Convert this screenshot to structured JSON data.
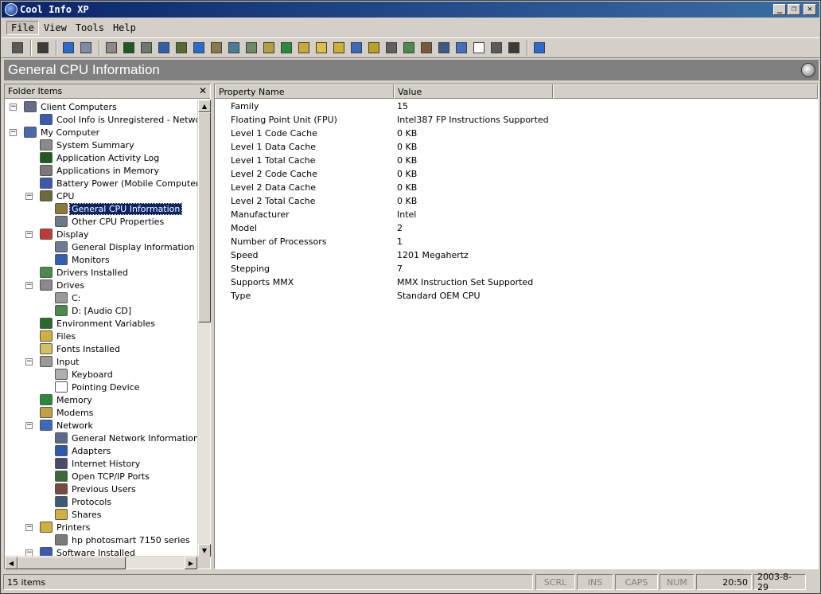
{
  "window": {
    "title": "Cool Info XP"
  },
  "menu": [
    {
      "label": "File",
      "active": true
    },
    {
      "label": "View"
    },
    {
      "label": "Tools"
    },
    {
      "label": "Help"
    }
  ],
  "toolbar": {
    "groups": [
      [
        "print-icon"
      ],
      [
        "connect-icon"
      ],
      [
        "cpu-info-icon",
        "cpu-props-icon"
      ],
      [
        "summary-icon",
        "activity-log-icon",
        "apps-memory-icon",
        "battery-icon",
        "cpu-icon",
        "display-icon",
        "display-info-icon",
        "monitor-icon",
        "drivers-icon",
        "drive-icon",
        "cdrom-icon",
        "env-icon",
        "files-icon",
        "fonts-icon",
        "keyboard-icon",
        "memory-icon",
        "modem-icon",
        "network-icon",
        "adapters-icon",
        "history-icon",
        "ports-icon",
        "sound-icon",
        "users-icon",
        "protocols-icon"
      ],
      [
        "help-icon"
      ]
    ],
    "colors": [
      "#5a5a5a",
      "#3a3a3a",
      "#2b6bd1",
      "#7a8ea8",
      "#8a8a8a",
      "#1e5a1e",
      "#6a7a6a",
      "#2f5fb0",
      "#556b2f",
      "#2a6ad0",
      "#8a7a4a",
      "#4a7a9a",
      "#6a8a6a",
      "#b0a040",
      "#2a8a3a",
      "#caa838",
      "#e0c040",
      "#d0b030",
      "#3a6ac0",
      "#c0a020",
      "#606060",
      "#4a8a4a",
      "#7a5a3a",
      "#3a5a8a",
      "#4070c0",
      "#ffffff"
    ]
  },
  "header": {
    "title": "General CPU Information"
  },
  "left_pane": {
    "title": "Folder Items",
    "close": "✕",
    "tree": [
      {
        "label": "Client Computers",
        "level": 0,
        "expander": "−",
        "icon": "network-computers-icon",
        "color": "#6a6a8a"
      },
      {
        "label": "Cool Info is Unregistered - Network V",
        "level": 1,
        "icon": "computer-lock-icon",
        "color": "#3a5ab0"
      },
      {
        "label": "My Computer",
        "level": 0,
        "expander": "−",
        "icon": "my-computer-icon",
        "color": "#4a6ab0"
      },
      {
        "label": "System Summary",
        "level": 1,
        "icon": "summary-icon",
        "color": "#8a8a8a"
      },
      {
        "label": "Application Activity Log",
        "level": 1,
        "icon": "activity-log-icon",
        "color": "#1e5a1e"
      },
      {
        "label": "Applications in Memory",
        "level": 1,
        "icon": "apps-memory-icon",
        "color": "#7a7a7a"
      },
      {
        "label": "Battery Power (Mobile Computers)",
        "level": 1,
        "icon": "battery-icon",
        "color": "#3a5ab0"
      },
      {
        "label": "CPU",
        "level": 1,
        "expander": "−",
        "icon": "cpu-icon",
        "color": "#6a6a3a"
      },
      {
        "label": "General CPU Information",
        "level": 2,
        "icon": "cpu-info-icon",
        "color": "#8a7a3a",
        "selected": true
      },
      {
        "label": "Other CPU Properties",
        "level": 2,
        "icon": "cpu-props-icon",
        "color": "#6a7a8a"
      },
      {
        "label": "Display",
        "level": 1,
        "expander": "−",
        "icon": "display-icon",
        "color": "#c03a3a"
      },
      {
        "label": "General Display Information",
        "level": 2,
        "icon": "display-info-icon",
        "color": "#6a7a9a"
      },
      {
        "label": "Monitors",
        "level": 2,
        "icon": "monitor-icon",
        "color": "#2f5fb0"
      },
      {
        "label": "Drivers Installed",
        "level": 1,
        "icon": "drivers-icon",
        "color": "#4a8a4a"
      },
      {
        "label": "Drives",
        "level": 1,
        "expander": "−",
        "icon": "drives-icon",
        "color": "#8a8a8a"
      },
      {
        "label": "C:",
        "level": 2,
        "icon": "drive-icon",
        "color": "#9a9a9a"
      },
      {
        "label": "D: [Audio CD]",
        "level": 2,
        "icon": "cdrom-icon",
        "color": "#4a8a4a"
      },
      {
        "label": "Environment Variables",
        "level": 1,
        "icon": "env-icon",
        "color": "#2a6a2a"
      },
      {
        "label": "Files",
        "level": 1,
        "icon": "files-icon",
        "color": "#d0b040"
      },
      {
        "label": "Fonts Installed",
        "level": 1,
        "icon": "fonts-icon",
        "color": "#d0c060"
      },
      {
        "label": "Input",
        "level": 1,
        "expander": "−",
        "icon": "input-icon",
        "color": "#9a9a9a"
      },
      {
        "label": "Keyboard",
        "level": 2,
        "icon": "keyboard-icon",
        "color": "#b0b0b0"
      },
      {
        "label": "Pointing Device",
        "level": 2,
        "icon": "mouse-icon",
        "color": "#ffffff"
      },
      {
        "label": "Memory",
        "level": 1,
        "icon": "memory-icon",
        "color": "#2a8a3a"
      },
      {
        "label": "Modems",
        "level": 1,
        "icon": "modem-icon",
        "color": "#c0a040"
      },
      {
        "label": "Network",
        "level": 1,
        "expander": "−",
        "icon": "network-icon",
        "color": "#3a6ac0"
      },
      {
        "label": "General Network Information",
        "level": 2,
        "icon": "network-info-icon",
        "color": "#5a6a8a"
      },
      {
        "label": "Adapters",
        "level": 2,
        "icon": "adapters-icon",
        "color": "#2a5ab0"
      },
      {
        "label": "Internet History",
        "level": 2,
        "icon": "history-icon",
        "color": "#4a4a6a"
      },
      {
        "label": "Open TCP/IP Ports",
        "level": 2,
        "icon": "ports-icon",
        "color": "#3a6a3a"
      },
      {
        "label": "Previous Users",
        "level": 2,
        "icon": "users-icon",
        "color": "#7a4a3a"
      },
      {
        "label": "Protocols",
        "level": 2,
        "icon": "protocols-icon",
        "color": "#3a5a7a"
      },
      {
        "label": "Shares",
        "level": 2,
        "icon": "shares-icon",
        "color": "#d0b040"
      },
      {
        "label": "Printers",
        "level": 1,
        "expander": "−",
        "icon": "printers-icon",
        "color": "#d0b040"
      },
      {
        "label": "hp photosmart 7150 series",
        "level": 2,
        "icon": "printer-icon",
        "color": "#7a7a7a"
      },
      {
        "label": "Software Installed",
        "level": 1,
        "expander": "−",
        "icon": "software-icon",
        "color": "#3a5ab0"
      }
    ]
  },
  "list": {
    "columns": [
      "Property Name",
      "Value"
    ],
    "rows": [
      {
        "name": "Family",
        "value": "15"
      },
      {
        "name": "Floating Point Unit (FPU)",
        "value": "Intel387 FP Instructions Supported"
      },
      {
        "name": "Level 1 Code Cache",
        "value": "0 KB"
      },
      {
        "name": "Level 1 Data Cache",
        "value": "0 KB"
      },
      {
        "name": "Level 1 Total Cache",
        "value": "0 KB"
      },
      {
        "name": "Level 2 Code Cache",
        "value": "0 KB"
      },
      {
        "name": "Level 2 Data Cache",
        "value": "0 KB"
      },
      {
        "name": "Level 2 Total Cache",
        "value": "0 KB"
      },
      {
        "name": "Manufacturer",
        "value": "Intel"
      },
      {
        "name": "Model",
        "value": "2"
      },
      {
        "name": "Number of Processors",
        "value": "1"
      },
      {
        "name": "Speed",
        "value": "1201 Megahertz"
      },
      {
        "name": "Stepping",
        "value": "7"
      },
      {
        "name": "Supports MMX",
        "value": "MMX Instruction Set Supported"
      },
      {
        "name": "Type",
        "value": "Standard OEM CPU"
      }
    ]
  },
  "status": {
    "items": "15 items",
    "scrl": "SCRL",
    "ins": "INS",
    "caps": "CAPS",
    "num": "NUM",
    "time": "20:50",
    "date": "2003-8-29"
  }
}
